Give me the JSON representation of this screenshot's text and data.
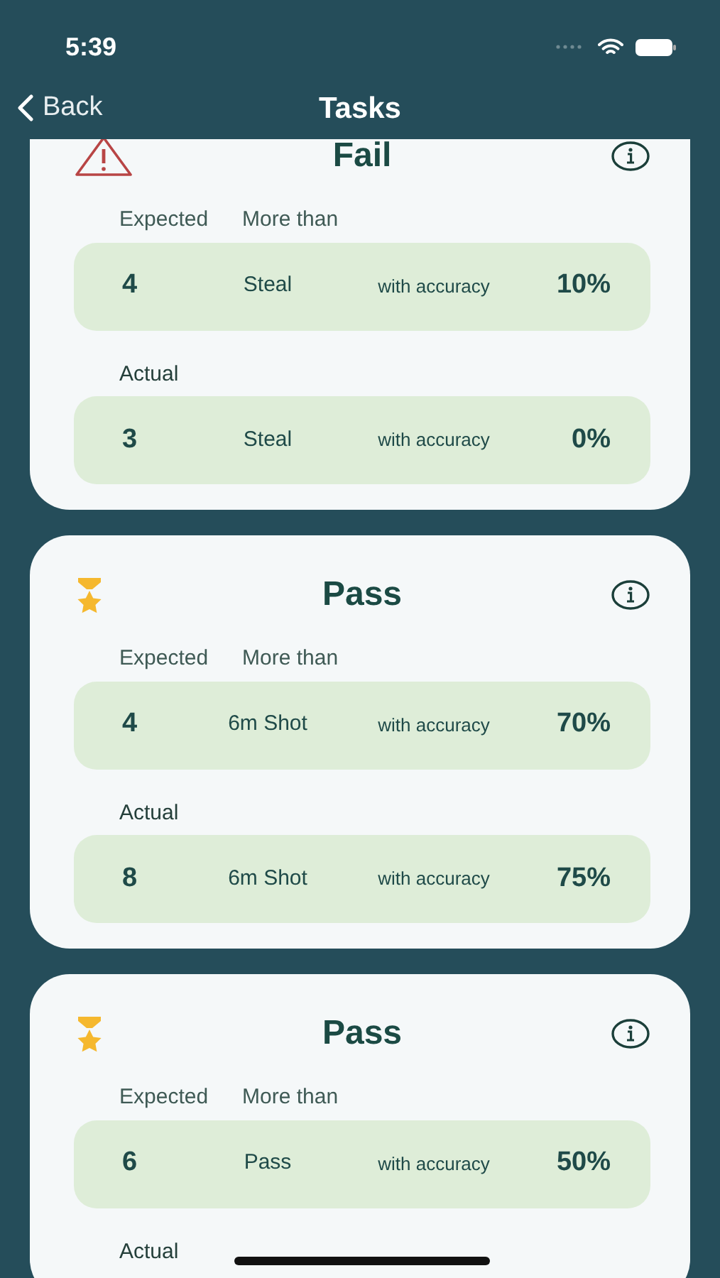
{
  "status_bar": {
    "time": "5:39"
  },
  "nav": {
    "back": "Back",
    "title": "Tasks"
  },
  "tasks": [
    {
      "kind": "fail",
      "result": "Fail",
      "expected_label": "Expected",
      "comparator": "More than",
      "expected": {
        "count": "4",
        "skill": "Steal",
        "accuracy_label": "with accuracy",
        "accuracy": "10%"
      },
      "actual_label": "Actual",
      "actual": {
        "count": "3",
        "skill": "Steal",
        "accuracy_label": "with accuracy",
        "accuracy": "0%"
      }
    },
    {
      "kind": "pass",
      "result": "Pass",
      "expected_label": "Expected",
      "comparator": "More than",
      "expected": {
        "count": "4",
        "skill": "6m Shot",
        "accuracy_label": "with accuracy",
        "accuracy": "70%"
      },
      "actual_label": "Actual",
      "actual": {
        "count": "8",
        "skill": "6m Shot",
        "accuracy_label": "with accuracy",
        "accuracy": "75%"
      }
    },
    {
      "kind": "pass",
      "result": "Pass",
      "expected_label": "Expected",
      "comparator": "More than",
      "expected": {
        "count": "6",
        "skill": "Pass",
        "accuracy_label": "with accuracy",
        "accuracy": "50%"
      },
      "actual_label": "Actual"
    }
  ]
}
